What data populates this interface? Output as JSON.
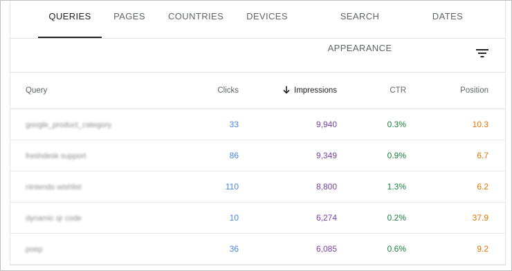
{
  "tabs": [
    {
      "label": "QUERIES",
      "active": true
    },
    {
      "label": "PAGES",
      "active": false
    },
    {
      "label": "COUNTRIES",
      "active": false
    },
    {
      "label": "DEVICES",
      "active": false
    },
    {
      "label": "SEARCH APPEARANCE",
      "active": false
    },
    {
      "label": "DATES",
      "active": false
    }
  ],
  "toolbar": {
    "filter_icon": "filter-icon"
  },
  "table": {
    "columns": {
      "query": "Query",
      "clicks": "Clicks",
      "impressions": "Impressions",
      "ctr": "CTR",
      "position": "Position"
    },
    "sorted_column": "impressions",
    "sort_direction": "descending",
    "rows": [
      {
        "query": "google_product_category",
        "clicks": "33",
        "impressions": "9,940",
        "ctr": "0.3%",
        "position": "10.3"
      },
      {
        "query": "freshdesk support",
        "clicks": "86",
        "impressions": "9,349",
        "ctr": "0.9%",
        "position": "6.7"
      },
      {
        "query": "nintendo wishlist",
        "clicks": "110",
        "impressions": "8,800",
        "ctr": "1.3%",
        "position": "6.2"
      },
      {
        "query": "dynamic qr code",
        "clicks": "10",
        "impressions": "6,274",
        "ctr": "0.2%",
        "position": "37.9"
      },
      {
        "query": "poep",
        "clicks": "36",
        "impressions": "6,085",
        "ctr": "0.6%",
        "position": "9.2"
      }
    ]
  },
  "colors": {
    "clicks": "#4285f4",
    "impressions": "#7b3fa8",
    "ctr": "#188038",
    "position": "#e37400"
  }
}
